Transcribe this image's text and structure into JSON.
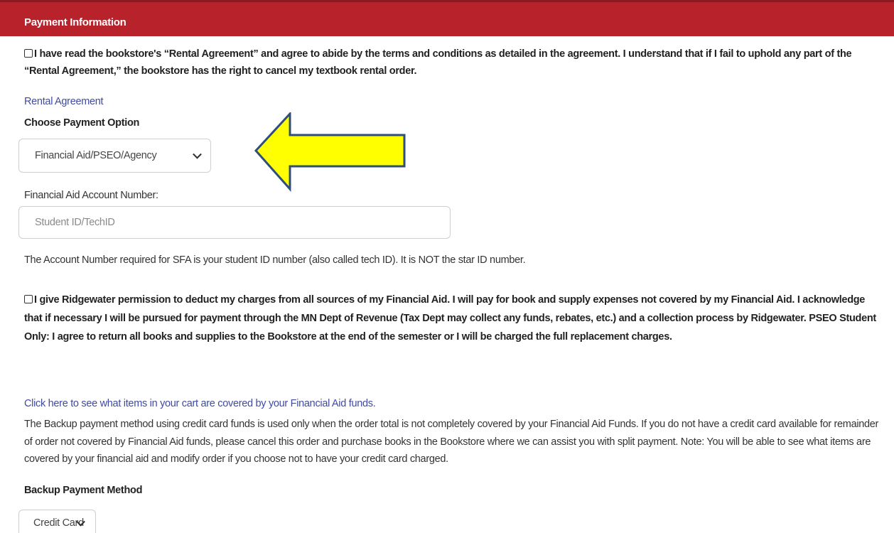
{
  "header": {
    "title": "Payment Information"
  },
  "rental": {
    "agreement_text": "I have read the bookstore's “Rental Agreement” and agree to abide by the terms and conditions as detailed in the agreement. I understand that if I fail to uphold any part of the “Rental Agreement,” the bookstore has the right to cancel my textbook rental order.",
    "agreement_checked": false,
    "agreement_link": "Rental Agreement"
  },
  "payment_option": {
    "label": "Choose Payment Option",
    "selected": "Financial Aid/PSEO/Agency"
  },
  "financial_aid": {
    "account_label": "Financial Aid Account Number:",
    "account_placeholder": "Student ID/TechID",
    "account_help": "The Account Number required for SFA is your student ID number (also called tech ID). It is NOT the star ID number.",
    "permission_text": "I give Ridgewater permission to deduct my charges from all sources of my Financial Aid. I will pay for book and supply expenses not covered by my Financial Aid. I acknowledge that if necessary I will be pursued for payment through the MN Dept of Revenue (Tax Dept may collect any funds, rebates, etc.) and a collection process by Ridgewater. PSEO Student Only: I agree to return all books and supplies to the Bookstore at the end of the semester or I will be charged the full replacement charges.",
    "permission_checked": false,
    "covered_link": "Click here to see what items in your cart are covered by your Financial Aid funds."
  },
  "backup": {
    "info_text": "The Backup payment method using credit card funds is used only when the order total is not completely covered by your Financial Aid Funds. If you do not have a credit card available for remainder of order not covered by Financial Aid funds, please cancel this order and purchase books in the Bookstore where we can assist you with split payment. Note: You will be able to see what items are covered by your financial aid and modify order if you choose not to have your credit card charged.",
    "label": "Backup Payment Method",
    "selected": "Credit Card"
  },
  "colors": {
    "header_bg": "#b8222b",
    "link": "#3f4aa2",
    "arrow_fill": "#ffff00",
    "arrow_stroke": "#2f4e7a"
  },
  "icons": {
    "dropdown": "chevron-down-icon",
    "annotation": "left-arrow-icon"
  }
}
